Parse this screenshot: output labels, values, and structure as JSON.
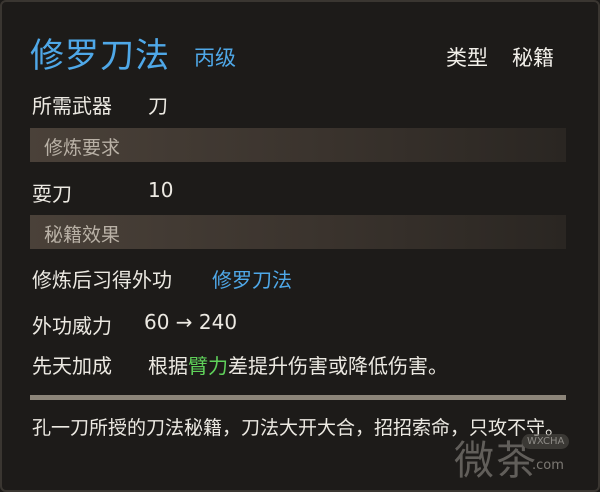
{
  "header": {
    "title": "修罗刀法",
    "grade": "丙级",
    "type_label": "类型",
    "type_value": "秘籍"
  },
  "weapon": {
    "label": "所需武器",
    "value": "刀"
  },
  "requirements": {
    "section_title": "修炼要求",
    "skill_label": "耍刀",
    "skill_value": "10"
  },
  "effects": {
    "section_title": "秘籍效果",
    "learn_label": "修炼后习得外功",
    "learn_value": "修罗刀法",
    "power_label": "外功威力",
    "power_value": "60 → 240",
    "innate_label": "先天加成",
    "innate_prefix": "根据",
    "innate_attr": "臂力",
    "innate_suffix": "差提升伤害或降低伤害。"
  },
  "description": "孔一刀所授的刀法秘籍，刀法大开大合，招招索命，只攻不守。",
  "watermark": {
    "char1": "微",
    "char2": "茶",
    "badge": "WXCHA",
    "url": ".com"
  }
}
